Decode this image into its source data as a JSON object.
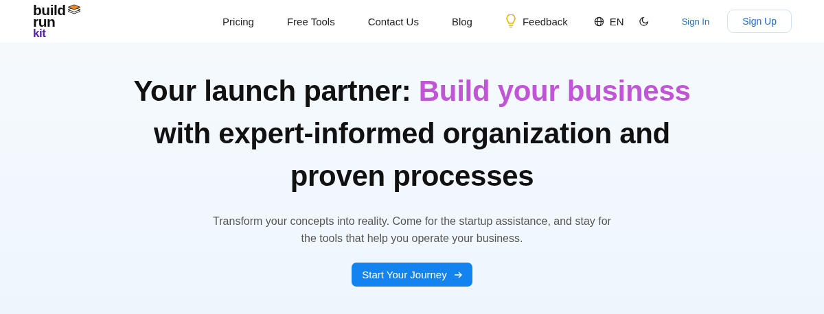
{
  "logo": {
    "top": "build",
    "bottom": "run",
    "accent": "kit"
  },
  "nav": [
    {
      "label": "Pricing",
      "kind": "link"
    },
    {
      "label": "Free Tools",
      "kind": "link"
    },
    {
      "label": "Contact Us",
      "kind": "link"
    },
    {
      "label": "Blog",
      "kind": "link"
    },
    {
      "label": "Feedback",
      "kind": "feedback"
    },
    {
      "label": "EN",
      "kind": "language"
    },
    {
      "kind": "theme"
    }
  ],
  "auth": {
    "sign_in": "Sign In",
    "sign_up": "Sign Up"
  },
  "hero": {
    "lead": "Your launch partner: ",
    "highlight": "Build your business",
    "rest": " with expert-informed organization and proven processes",
    "subtitle": "Transform your concepts into reality. Come for the startup assistance, and stay for the tools that help you operate your business.",
    "cta": "Start Your Journey"
  }
}
